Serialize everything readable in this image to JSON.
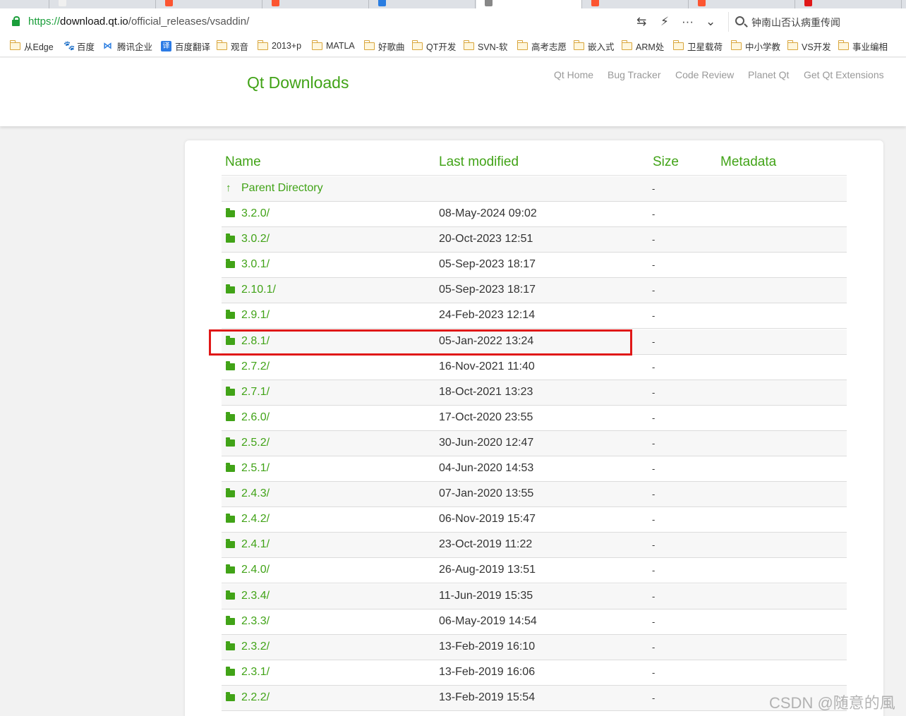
{
  "browser": {
    "tabs": [
      {
        "color": "#e0e0e0"
      },
      {
        "color": "#f0f0f0"
      },
      {
        "color": "#fc5531"
      },
      {
        "color": "#fc5531"
      },
      {
        "color": "#2a7de1"
      },
      {
        "color": "#888888"
      },
      {
        "color": "#fc5531"
      },
      {
        "color": "#fc5531"
      },
      {
        "color": "#e01818"
      }
    ],
    "url": {
      "scheme": "https://",
      "host": "download.qt.io",
      "path": "/official_releases/vsaddin/"
    },
    "url_tools": [
      "⇆",
      "⚡",
      "···",
      "⌄"
    ],
    "search_text": "钟南山否认病重传闻",
    "bookmarks": [
      {
        "label": "从Edge",
        "icon": "folder-icon"
      },
      {
        "label": "百度",
        "icon": "paw-icon",
        "glyph": "🐾"
      },
      {
        "label": "腾讯企业",
        "icon": "tx-icon",
        "glyph": "⋈"
      },
      {
        "label": "百度翻译",
        "icon": "fy-icon",
        "glyph": "译"
      },
      {
        "label": "观音",
        "icon": "folder-icon"
      },
      {
        "label": "2013+p",
        "icon": "folder-icon"
      },
      {
        "label": "MATLA",
        "icon": "folder-icon"
      },
      {
        "label": "好歌曲",
        "icon": "folder-icon"
      },
      {
        "label": "QT开发",
        "icon": "folder-icon"
      },
      {
        "label": "SVN-软",
        "icon": "folder-icon"
      },
      {
        "label": "高考志愿",
        "icon": "folder-icon"
      },
      {
        "label": "嵌入式",
        "icon": "folder-icon"
      },
      {
        "label": "ARM处",
        "icon": "folder-icon"
      },
      {
        "label": "卫星载荷",
        "icon": "folder-icon"
      },
      {
        "label": "中小学教",
        "icon": "folder-icon"
      },
      {
        "label": "VS开发",
        "icon": "folder-icon"
      },
      {
        "label": "事业编相",
        "icon": "folder-icon"
      }
    ]
  },
  "site": {
    "title": "Qt Downloads",
    "nav": [
      "Qt Home",
      "Bug Tracker",
      "Code Review",
      "Planet Qt",
      "Get Qt Extensions"
    ],
    "accent": "#41a317"
  },
  "listing": {
    "headers": {
      "name": "Name",
      "modified": "Last modified",
      "size": "Size",
      "metadata": "Metadata"
    },
    "parent": {
      "name": "Parent Directory",
      "size": "-"
    },
    "rows": [
      {
        "name": "3.2.0/",
        "modified": "08-May-2024 09:02",
        "size": "-"
      },
      {
        "name": "3.0.2/",
        "modified": "20-Oct-2023 12:51",
        "size": "-"
      },
      {
        "name": "3.0.1/",
        "modified": "05-Sep-2023 18:17",
        "size": "-"
      },
      {
        "name": "2.10.1/",
        "modified": "05-Sep-2023 18:17",
        "size": "-"
      },
      {
        "name": "2.9.1/",
        "modified": "24-Feb-2023 12:14",
        "size": "-"
      },
      {
        "name": "2.8.1/",
        "modified": "05-Jan-2022 13:24",
        "size": "-",
        "highlighted": true
      },
      {
        "name": "2.7.2/",
        "modified": "16-Nov-2021 11:40",
        "size": "-"
      },
      {
        "name": "2.7.1/",
        "modified": "18-Oct-2021 13:23",
        "size": "-"
      },
      {
        "name": "2.6.0/",
        "modified": "17-Oct-2020 23:55",
        "size": "-"
      },
      {
        "name": "2.5.2/",
        "modified": "30-Jun-2020 12:47",
        "size": "-"
      },
      {
        "name": "2.5.1/",
        "modified": "04-Jun-2020 14:53",
        "size": "-"
      },
      {
        "name": "2.4.3/",
        "modified": "07-Jan-2020 13:55",
        "size": "-"
      },
      {
        "name": "2.4.2/",
        "modified": "06-Nov-2019 15:47",
        "size": "-"
      },
      {
        "name": "2.4.1/",
        "modified": "23-Oct-2019 11:22",
        "size": "-"
      },
      {
        "name": "2.4.0/",
        "modified": "26-Aug-2019 13:51",
        "size": "-"
      },
      {
        "name": "2.3.4/",
        "modified": "11-Jun-2019 15:35",
        "size": "-"
      },
      {
        "name": "2.3.3/",
        "modified": "06-May-2019 14:54",
        "size": "-"
      },
      {
        "name": "2.3.2/",
        "modified": "13-Feb-2019 16:10",
        "size": "-"
      },
      {
        "name": "2.3.1/",
        "modified": "13-Feb-2019 16:06",
        "size": "-"
      },
      {
        "name": "2.2.2/",
        "modified": "13-Feb-2019 15:54",
        "size": "-"
      }
    ],
    "highlight_color": "#e01818"
  },
  "watermark": "CSDN @随意的風"
}
